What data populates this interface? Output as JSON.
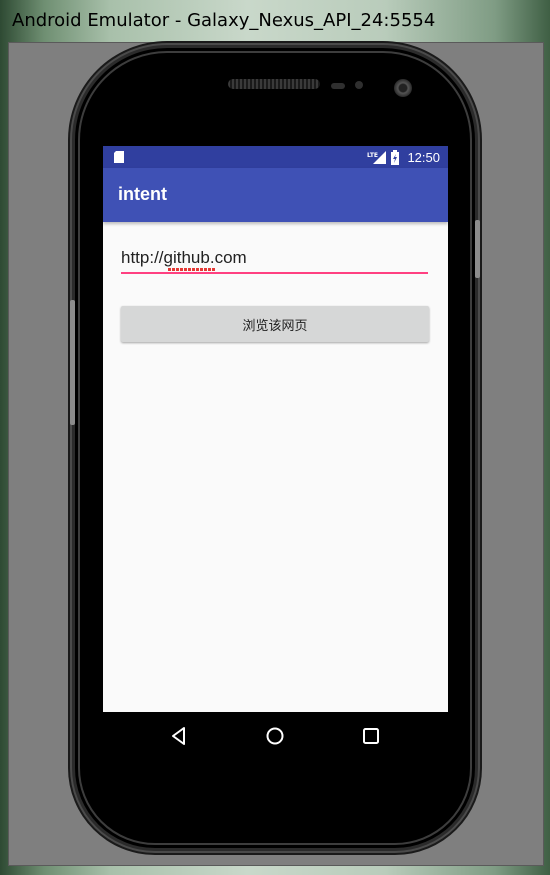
{
  "window": {
    "title": "Android Emulator - Galaxy_Nexus_API_24:5554"
  },
  "statusbar": {
    "time": "12:50",
    "network": "LTE"
  },
  "appbar": {
    "title": "intent"
  },
  "url_field": {
    "value": "http://github.com",
    "misspelled_word": "github"
  },
  "browse_button": {
    "label": "浏览该网页"
  },
  "colors": {
    "status_bar": "#303f9f",
    "app_bar": "#3f51b5",
    "accent": "#ff4081",
    "button": "#d6d7d7",
    "screen_bg": "#fafafa"
  },
  "icons": {
    "status": [
      "sd-card-icon",
      "lte-signal-icon",
      "battery-charging-icon"
    ],
    "nav": [
      "back-icon",
      "home-icon",
      "recents-icon"
    ]
  }
}
